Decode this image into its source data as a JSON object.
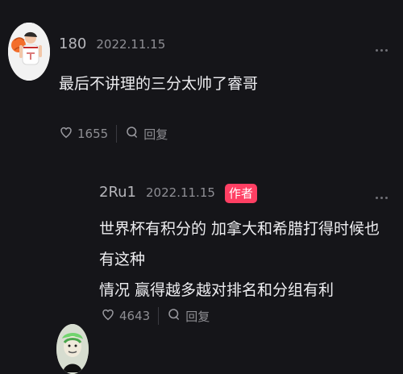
{
  "comments": [
    {
      "username": "180",
      "date": "2022.11.15",
      "text": "最后不讲理的三分太帅了睿哥",
      "likes": "1655",
      "reply_label": "回复",
      "avatar": "basketball-player-avatar",
      "more": "more-icon"
    },
    {
      "username": "2Ru1",
      "date": "2022.11.15",
      "badge": "作者",
      "text_line_1": "世界杯有积分的 加拿大和希腊打得时候也有这种",
      "text_line_2": "情况 赢得越多越对排名和分组有利",
      "likes": "4643",
      "reply_label": "回复",
      "avatar": "cartoon-avatar",
      "more": "more-icon"
    }
  ]
}
